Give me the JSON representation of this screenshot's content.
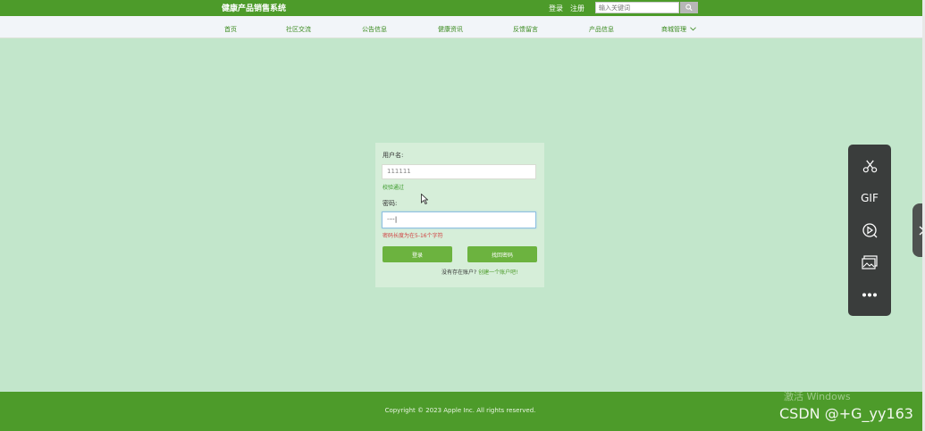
{
  "header": {
    "brand": "健康产品销售系统",
    "login": "登录",
    "register": "注册",
    "search_placeholder": "输入关键词"
  },
  "nav": {
    "items": [
      "首页",
      "社区交流",
      "公告信息",
      "健康资讯",
      "反馈留言",
      "产品信息",
      "商城管理"
    ]
  },
  "form": {
    "username_label": "用户名:",
    "username_value": "111111",
    "username_msg": "校验通过",
    "password_label": "密码:",
    "password_value": "····|",
    "password_msg": "密码长度为在5-16个字符",
    "login_button": "登录",
    "forgot_button": "找回密码",
    "no_account_text": "没有存在账户?",
    "create_account_link": "创建一个账户吧!"
  },
  "toolbar": {
    "icons": [
      "scissors-icon",
      "gif-icon",
      "record-icon",
      "image-icon",
      "more-icon"
    ],
    "gif_label": "GIF"
  },
  "footer": {
    "copyright": "Copyright © 2023 Apple Inc. All rights reserved."
  },
  "watermarks": {
    "windows": "激活 Windows",
    "csdn": "CSDN @+G_yy163"
  },
  "colors": {
    "primary": "#4d9b2a",
    "background": "#c2e6cb",
    "button": "#6cb33f"
  }
}
